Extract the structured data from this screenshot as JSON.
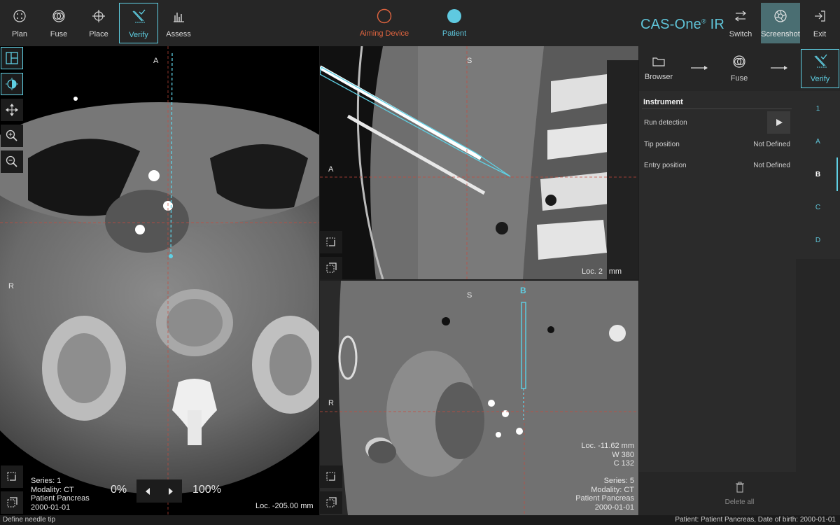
{
  "toolbar": {
    "items": [
      {
        "label": "Plan",
        "icon": "plan-icon"
      },
      {
        "label": "Fuse",
        "icon": "fuse-icon"
      },
      {
        "label": "Place",
        "icon": "place-icon"
      },
      {
        "label": "Verify",
        "icon": "verify-icon",
        "active": true
      },
      {
        "label": "Assess",
        "icon": "assess-icon"
      }
    ],
    "status": [
      {
        "label": "Aiming Device",
        "color": "#e0643f",
        "icon": "aiming-device-status-icon"
      },
      {
        "label": "Patient",
        "color": "#5fc9e0",
        "icon": "patient-status-icon"
      }
    ],
    "brand": "CAS-One",
    "brand_mark": "®",
    "brand_suffix": " IR",
    "right": [
      {
        "label": "Switch",
        "icon": "switch-icon"
      },
      {
        "label": "Screenshot",
        "icon": "screenshot-icon"
      },
      {
        "label": "Exit",
        "icon": "exit-icon"
      }
    ]
  },
  "viewports": {
    "axial": {
      "orient_top": "A",
      "orient_left": "R",
      "series": "Series: 1",
      "modality": "Modality: CT",
      "patient": "Patient Pancreas",
      "date": "2000-01-01",
      "slider_min": "0%",
      "slider_max": "100%",
      "loc": "Loc. -205.00 mm"
    },
    "sagittal": {
      "orient_top": "S",
      "orient_left": "A",
      "loc": "Loc. 2    mm"
    },
    "coronal": {
      "orient_top": "S",
      "orient_left": "R",
      "trajectory_label": "B",
      "loc": "Loc. -11.62 mm",
      "window": "W 380",
      "center": "C 132",
      "series": "Series: 5",
      "modality": "Modality: CT",
      "patient": "Patient Pancreas",
      "date": "2000-01-01"
    }
  },
  "workflow": {
    "steps": [
      {
        "label": "Browser",
        "icon": "folder-icon"
      },
      {
        "label": "Fuse",
        "icon": "fuse-icon"
      },
      {
        "label": "Verify",
        "icon": "verify-icon",
        "active": true
      }
    ]
  },
  "instrument": {
    "title": "Instrument",
    "run_detection": "Run detection",
    "tip_label": "Tip position",
    "tip_value": "Not Defined",
    "entry_label": "Entry position",
    "entry_value": "Not Defined"
  },
  "trajectories": [
    "1",
    "A",
    "B",
    "C",
    "D"
  ],
  "selected_trajectory": "B",
  "delete_all": "Delete all",
  "status_bar": {
    "hint": "Define needle tip",
    "patient_info": "Patient: Patient Pancreas,  Date of birth: 2000-01-01"
  },
  "colors": {
    "accent": "#5fd0e4",
    "aiming": "#e0643f"
  }
}
